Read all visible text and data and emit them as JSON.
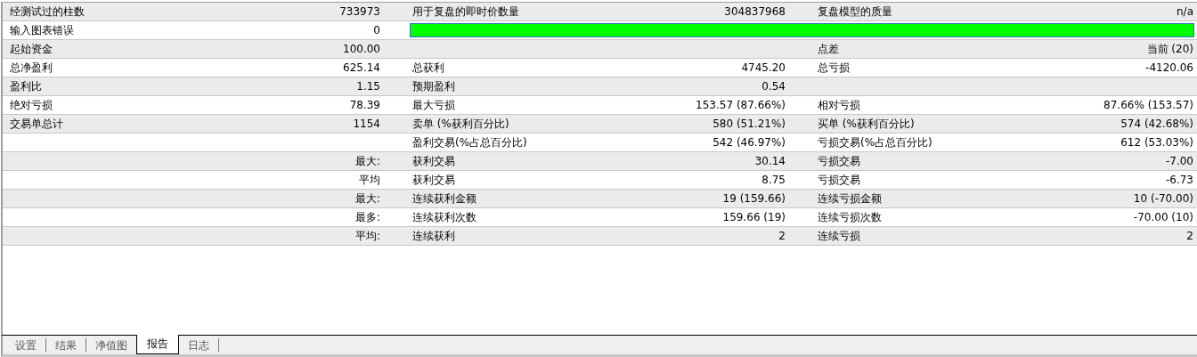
{
  "report": {
    "rows": [
      {
        "cells": [
          {
            "label": "经测试过的柱数",
            "value": "733973"
          },
          {
            "label": "用于复盘的即时价数量",
            "value": "304837968"
          },
          {
            "label": "复盘模型的质量",
            "value": "n/a"
          }
        ]
      },
      {
        "cells": [
          {
            "label": "输入图表错误",
            "value": "0"
          }
        ],
        "quality_bar": {
          "level": 1
        }
      },
      {
        "cells": [
          {
            "label": "起始资金",
            "value": "100.00"
          },
          {},
          {
            "label": "点差",
            "value": "当前 (20)"
          }
        ]
      },
      {
        "cells": [
          {
            "label": "总净盈利",
            "value": "625.14"
          },
          {
            "label": "总获利",
            "value": "4745.20"
          },
          {
            "label": "总亏损",
            "value": "-4120.06"
          }
        ]
      },
      {
        "cells": [
          {
            "label": "盈利比",
            "value": "1.15"
          },
          {
            "label": "预期盈利",
            "value": "0.54"
          },
          {}
        ]
      },
      {
        "cells": [
          {
            "label": "绝对亏损",
            "value": "78.39"
          },
          {
            "label": "最大亏损",
            "value": "153.57 (87.66%)"
          },
          {
            "label": "相对亏损",
            "value": "87.66% (153.57)"
          }
        ]
      },
      {
        "cells": [
          {
            "label": "交易单总计",
            "value": "1154"
          },
          {
            "label": "卖单 (%获利百分比)",
            "value": "580 (51.21%)"
          },
          {
            "label": "买单 (%获利百分比)",
            "value": "574 (42.68%)"
          }
        ]
      },
      {
        "cells": [
          {},
          {
            "label": "盈利交易(%占总百分比)",
            "value": "542 (46.97%)"
          },
          {
            "label": "亏损交易(%占总百分比)",
            "value": "612 (53.03%)"
          }
        ]
      },
      {
        "cells": [
          {
            "value": "最大:"
          },
          {
            "label": "获利交易",
            "value": "30.14"
          },
          {
            "label": "亏损交易",
            "value": "-7.00"
          }
        ]
      },
      {
        "cells": [
          {
            "value": "平均"
          },
          {
            "label": "获利交易",
            "value": "8.75"
          },
          {
            "label": "亏损交易",
            "value": "-6.73"
          }
        ]
      },
      {
        "cells": [
          {
            "value": "最大:"
          },
          {
            "label": "连续获利金额",
            "value": "19 (159.66)"
          },
          {
            "label": "连续亏损金额",
            "value": "10 (-70.00)"
          }
        ]
      },
      {
        "cells": [
          {
            "value": "最多:"
          },
          {
            "label": "连续获利次数",
            "value": "159.66 (19)"
          },
          {
            "label": "连续亏损次数",
            "value": "-70.00 (10)"
          }
        ]
      },
      {
        "cells": [
          {
            "value": "平均:"
          },
          {
            "label": "连续获利",
            "value": "2"
          },
          {
            "label": "连续亏损",
            "value": "2"
          }
        ]
      }
    ]
  },
  "tabs": [
    {
      "label": "设置",
      "selected": false
    },
    {
      "label": "结果",
      "selected": false
    },
    {
      "label": "净值图",
      "selected": false
    },
    {
      "label": "报告",
      "selected": true
    },
    {
      "label": "日志",
      "selected": false
    }
  ]
}
